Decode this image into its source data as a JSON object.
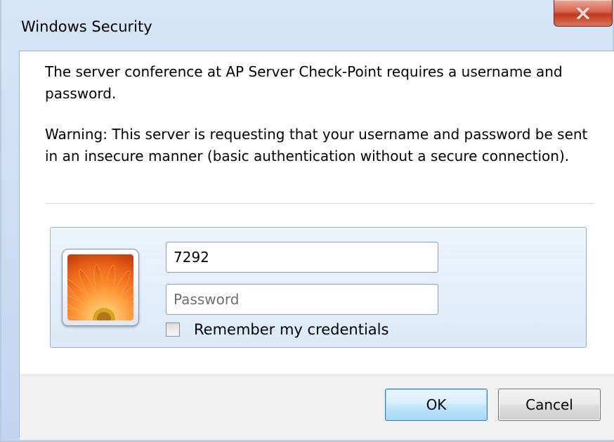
{
  "window": {
    "title": "Windows Security"
  },
  "message": {
    "line1": "The server conference at AP Server Check-Point requires a username and password.",
    "warning": "Warning: This server is requesting that your username and password be sent in an insecure manner (basic authentication without a secure connection)."
  },
  "credentials": {
    "username_value": "7292",
    "password_value": "",
    "password_placeholder": "Password",
    "remember_label": "Remember my credentials",
    "remember_checked": false
  },
  "buttons": {
    "ok_label": "OK",
    "cancel_label": "Cancel"
  },
  "icons": {
    "close": "close-icon",
    "avatar": "user-tile-icon"
  },
  "colors": {
    "close_button": "#c9432a",
    "panel_border": "#8fb3dc",
    "ok_border": "#3c7fb1"
  }
}
